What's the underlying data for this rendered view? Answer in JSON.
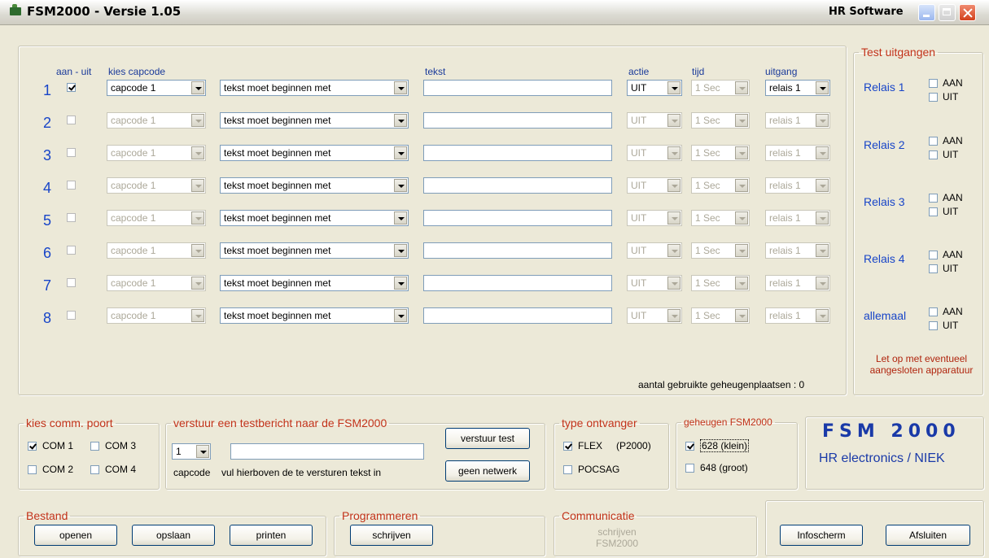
{
  "window": {
    "title": "FSM2000 - Versie 1.05",
    "brand": "HR Software"
  },
  "headers": {
    "aan_uit": "aan - uit",
    "kies_capcode": "kies capcode",
    "tekst": "tekst",
    "actie": "actie",
    "tijd": "tijd",
    "uitgang": "uitgang"
  },
  "rows": [
    {
      "num": "1",
      "checked": true,
      "capcode": "capcode 1",
      "mode": "tekst moet beginnen met",
      "text": "",
      "actie": "UIT",
      "tijd": "1 Sec",
      "uitgang": "relais 1"
    },
    {
      "num": "2",
      "checked": false,
      "capcode": "capcode 1",
      "mode": "tekst moet beginnen met",
      "text": "",
      "actie": "UIT",
      "tijd": "1 Sec",
      "uitgang": "relais 1"
    },
    {
      "num": "3",
      "checked": false,
      "capcode": "capcode 1",
      "mode": "tekst moet beginnen met",
      "text": "",
      "actie": "UIT",
      "tijd": "1 Sec",
      "uitgang": "relais 1"
    },
    {
      "num": "4",
      "checked": false,
      "capcode": "capcode 1",
      "mode": "tekst moet beginnen met",
      "text": "",
      "actie": "UIT",
      "tijd": "1 Sec",
      "uitgang": "relais 1"
    },
    {
      "num": "5",
      "checked": false,
      "capcode": "capcode 1",
      "mode": "tekst moet beginnen met",
      "text": "",
      "actie": "UIT",
      "tijd": "1 Sec",
      "uitgang": "relais 1"
    },
    {
      "num": "6",
      "checked": false,
      "capcode": "capcode 1",
      "mode": "tekst moet beginnen met",
      "text": "",
      "actie": "UIT",
      "tijd": "1 Sec",
      "uitgang": "relais 1"
    },
    {
      "num": "7",
      "checked": false,
      "capcode": "capcode 1",
      "mode": "tekst moet beginnen met",
      "text": "",
      "actie": "UIT",
      "tijd": "1 Sec",
      "uitgang": "relais 1"
    },
    {
      "num": "8",
      "checked": false,
      "capcode": "capcode 1",
      "mode": "tekst moet beginnen met",
      "text": "",
      "actie": "UIT",
      "tijd": "1 Sec",
      "uitgang": "relais 1"
    }
  ],
  "memory_used": "aantal gebruikte geheugenplaatsen : 0",
  "test_outputs": {
    "legend": "Test uitgangen",
    "relays": [
      {
        "label": "Relais 1",
        "aan": "AAN",
        "uit": "UIT"
      },
      {
        "label": "Relais 2",
        "aan": "AAN",
        "uit": "UIT"
      },
      {
        "label": "Relais 3",
        "aan": "AAN",
        "uit": "UIT"
      },
      {
        "label": "Relais 4",
        "aan": "AAN",
        "uit": "UIT"
      },
      {
        "label": "allemaal",
        "aan": "AAN",
        "uit": "UIT"
      }
    ],
    "warning_line1": "Let op met eventueel",
    "warning_line2": "aangesloten apparatuur"
  },
  "comm_port": {
    "legend": "kies comm. poort",
    "com1": "COM 1",
    "com2": "COM 2",
    "com3": "COM 3",
    "com4": "COM 4",
    "com1_checked": true
  },
  "test_message": {
    "legend": "verstuur een testbericht naar de FSM2000",
    "capcode_value": "1",
    "capcode_label": "capcode",
    "hint": "vul hierboven de te versturen tekst in",
    "send_button": "verstuur test",
    "no_network_button": "geen netwerk"
  },
  "receiver": {
    "legend": "type ontvanger",
    "flex": "FLEX",
    "flex_note": "(P2000)",
    "pocsag": "POCSAG"
  },
  "memory": {
    "legend": "geheugen FSM2000",
    "small": "628 (klein)",
    "large": "648 (groot)"
  },
  "brand_box": {
    "title": "FSM 2000",
    "subtitle": "HR electronics / NIEK"
  },
  "bestand": {
    "legend": "Bestand",
    "open": "openen",
    "save": "opslaan",
    "print": "printen"
  },
  "programmeren": {
    "legend": "Programmeren",
    "write": "schrijven"
  },
  "communicatie": {
    "legend": "Communicatie",
    "line1": "schrijven",
    "line2": "FSM2000"
  },
  "buttons": {
    "info": "Infoscherm",
    "close": "Afsluiten"
  }
}
